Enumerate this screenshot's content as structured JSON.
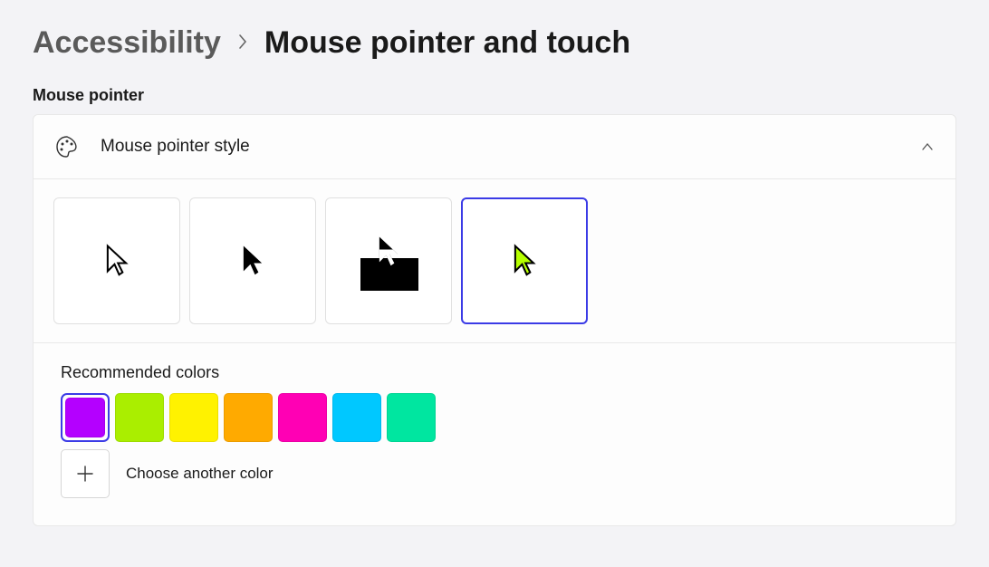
{
  "breadcrumb": {
    "parent": "Accessibility",
    "current": "Mouse pointer and touch"
  },
  "section_label": "Mouse pointer",
  "panel": {
    "title": "Mouse pointer style"
  },
  "styles": [
    {
      "id": "white",
      "selected": false
    },
    {
      "id": "black",
      "selected": false
    },
    {
      "id": "inverted",
      "selected": false
    },
    {
      "id": "custom",
      "selected": true
    }
  ],
  "custom_cursor_color": "#b6ff00",
  "colors": {
    "label": "Recommended colors",
    "swatches": [
      {
        "hex": "#b400ff",
        "selected": true
      },
      {
        "hex": "#aaee00",
        "selected": false
      },
      {
        "hex": "#fff200",
        "selected": false
      },
      {
        "hex": "#ffaa00",
        "selected": false
      },
      {
        "hex": "#ff00b4",
        "selected": false
      },
      {
        "hex": "#00c8ff",
        "selected": false
      },
      {
        "hex": "#00e6a0",
        "selected": false
      }
    ],
    "choose_label": "Choose another color"
  }
}
